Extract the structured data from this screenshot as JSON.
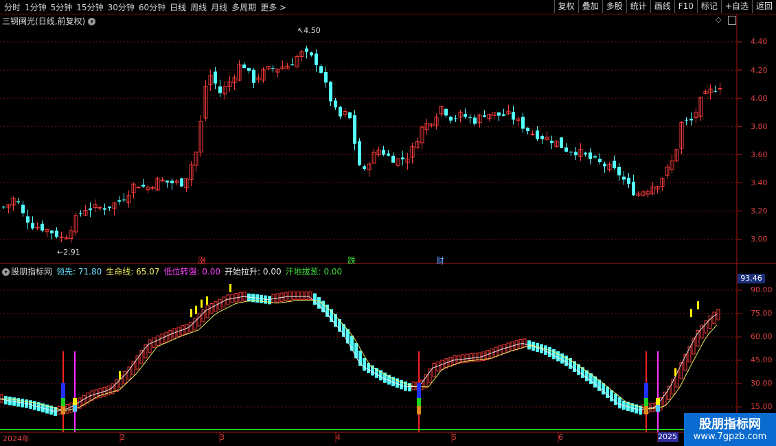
{
  "toolbar": {
    "periods": [
      "分时",
      "1分钟",
      "5分钟",
      "15分钟",
      "30分钟",
      "60分钟",
      "日线",
      "周线",
      "月线",
      "多周期",
      "更多 >"
    ],
    "active_period": "日线",
    "actions": [
      "复权",
      "叠加",
      "多股",
      "统计",
      "画线",
      "F10",
      "标记",
      "+自选",
      "返回"
    ]
  },
  "stock": {
    "name": "三钢闽光",
    "period_info": "(日线,前复权)",
    "max_label": "4.50",
    "min_label": "2.91",
    "markers": [
      "涨",
      "跌",
      "财"
    ]
  },
  "indicator": {
    "name": "股朋指标网",
    "values": [
      {
        "label": "领先: 71.80",
        "color": "#6fe0ff"
      },
      {
        "label": "生命线: 65.07",
        "color": "#f0f060"
      },
      {
        "label": "低位转强: 0.00",
        "color": "#ff40ff"
      },
      {
        "label": "开始拉升: 0.00",
        "color": "#f0f0f0"
      },
      {
        "label": "汗地拔葱: 0.00",
        "color": "#40e040"
      }
    ],
    "current": "93.46"
  },
  "price_axis": [
    "4.40",
    "4.20",
    "4.00",
    "3.80",
    "3.60",
    "3.40",
    "3.20",
    "3.00"
  ],
  "ind_axis": [
    "90.00",
    "75.00",
    "60.00",
    "45.00",
    "30.00",
    "15.00"
  ],
  "x_axis": [
    "2024年",
    "2",
    "3",
    "4",
    "5",
    "6",
    "2025"
  ],
  "watermark": {
    "title": "股朋指标网",
    "url": "www.7gpzb.com"
  },
  "colors": {
    "up": "#ff3c3c",
    "down": "#54ffff",
    "grid": "#7a1010"
  }
}
